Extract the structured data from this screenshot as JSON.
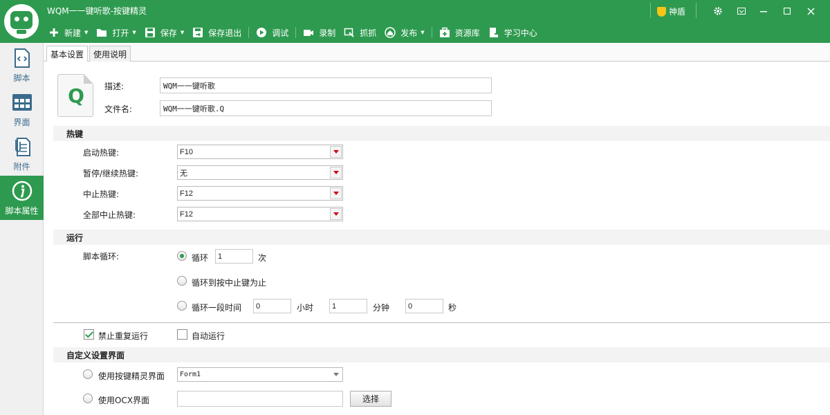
{
  "window": {
    "title": "WQM一一键听歌-按键精灵",
    "shield_label": "神盾"
  },
  "toolbar": {
    "new_label": "新建",
    "open_label": "打开",
    "save_label": "保存",
    "save_exit_label": "保存退出",
    "debug_label": "调试",
    "record_label": "录制",
    "grab_label": "抓抓",
    "publish_label": "发布",
    "resource_label": "资源库",
    "learn_label": "学习中心"
  },
  "sidebar": {
    "items": [
      {
        "label": "脚本",
        "icon": "script-icon"
      },
      {
        "label": "界面",
        "icon": "grid-icon"
      },
      {
        "label": "附件",
        "icon": "attachment-icon"
      },
      {
        "label": "脚本属性",
        "icon": "info-icon",
        "active": true
      }
    ]
  },
  "tabs": [
    {
      "label": "基本设置",
      "active": true
    },
    {
      "label": "使用说明"
    }
  ],
  "basic": {
    "desc_label": "描述:",
    "desc_value": "WQM一一键听歌",
    "filename_label": "文件名:",
    "filename_value": "WQM一一键听歌.Q",
    "file_icon_letter": "Q"
  },
  "hotkeys": {
    "title": "热键",
    "rows": [
      {
        "label": "启动热键:",
        "value": "F10"
      },
      {
        "label": "暂停/继续热键:",
        "value": "无"
      },
      {
        "label": "中止热键:",
        "value": "F12"
      },
      {
        "label": "全部中止热键:",
        "value": "F12"
      }
    ]
  },
  "run": {
    "title": "运行",
    "loop_label": "脚本循环:",
    "opt_loop_label": "循环",
    "loop_count": "1",
    "times_unit": "次",
    "opt_until_stop_label": "循环到按中止键为止",
    "opt_duration_label": "循环一段时间",
    "hours_value": "0",
    "hours_unit": "小时",
    "minutes_value": "1",
    "minutes_unit": "分钟",
    "seconds_value": "0",
    "seconds_unit": "秒",
    "selected_option": "loop"
  },
  "options": {
    "no_repeat_label": "禁止重复运行",
    "no_repeat_checked": true,
    "auto_run_label": "自动运行",
    "auto_run_checked": false
  },
  "custom_ui": {
    "title": "自定义设置界面",
    "use_builtin_label": "使用按键精灵界面",
    "builtin_value": "Form1",
    "use_ocx_label": "使用OCX界面",
    "ocx_value": "",
    "choose_label": "选择"
  },
  "colors": {
    "accent": "#2e9a4f",
    "arrow_red": "#d0021b"
  }
}
